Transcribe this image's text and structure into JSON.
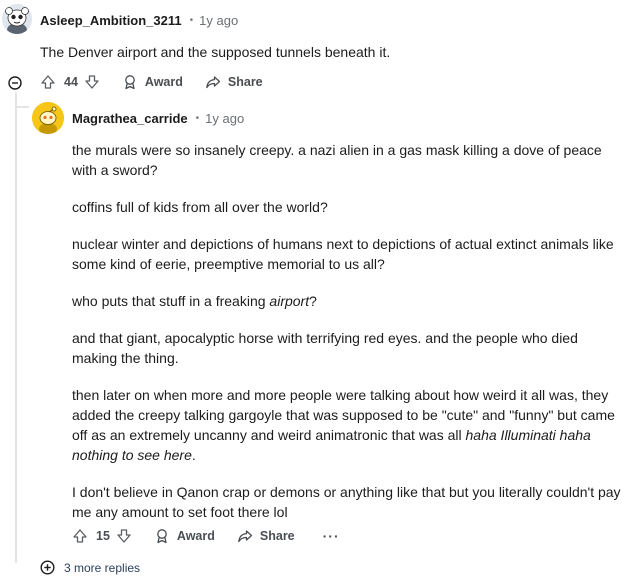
{
  "comment1": {
    "username": "Asleep_Ambition_3211",
    "separator": "•",
    "timestamp": "1y ago",
    "text": "The Denver airport and the supposed tunnels beneath it.",
    "upvotes": "44",
    "award_label": "Award",
    "share_label": "Share"
  },
  "comment2": {
    "username": "Magrathea_carride",
    "separator": "•",
    "timestamp": "1y ago",
    "paragraphs": [
      "the murals were so insanely creepy. a nazi alien in a gas mask killing a dove of peace with a sword?",
      "coffins full of kids from all over the world?",
      "nuclear winter and depictions of humans next to depictions of actual extinct animals like some kind of eerie, preemptive memorial to us all?"
    ],
    "p4_before": "who puts that stuff in a freaking ",
    "p4_italic": "airport",
    "p4_after": "?",
    "p5": "and that giant, apocalyptic horse with terrifying red eyes. and the people who died making the thing.",
    "p6_before": "then later on when more and more people were talking about how weird it all was, they added the creepy talking gargoyle that was supposed to be \"cute\" and \"funny\" but came off as an extremely uncanny and weird animatronic that was all ",
    "p6_italic": "haha Illuminati haha nothing to see here",
    "p6_after": ".",
    "p7": "I don't believe in Qanon crap or demons or anything like that but you literally couldn't pay me any amount to set foot there lol",
    "upvotes": "15",
    "award_label": "Award",
    "share_label": "Share",
    "more_label": "···"
  },
  "more_replies_label": "3 more replies",
  "icons": {
    "upvote": "arrow-up-icon",
    "downvote": "arrow-down-icon",
    "award": "award-icon",
    "share": "share-icon",
    "collapse": "minus-circle-icon",
    "expand": "plus-circle-icon"
  },
  "colors": {
    "text": "#1c1c1c",
    "muted": "#6a6f73",
    "thread_line": "#e2e4e6",
    "snoo_yellow": "#f5c518"
  }
}
